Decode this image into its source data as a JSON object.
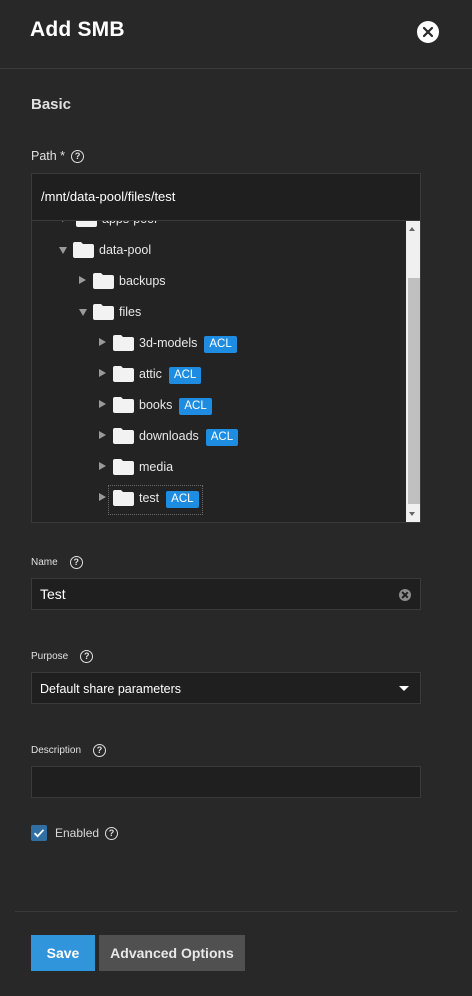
{
  "header": {
    "title": "Add SMB"
  },
  "section": {
    "title": "Basic"
  },
  "path": {
    "label": "Path *",
    "value": "/mnt/data-pool/files/test",
    "tree": [
      {
        "label": "apps-pool",
        "expanded": false,
        "acl": ""
      },
      {
        "label": "data-pool",
        "expanded": true,
        "acl": ""
      },
      {
        "label": "backups",
        "expanded": false,
        "acl": ""
      },
      {
        "label": "files",
        "expanded": true,
        "acl": ""
      },
      {
        "label": "3d-models",
        "expanded": false,
        "acl": "ACL"
      },
      {
        "label": "attic",
        "expanded": false,
        "acl": "ACL"
      },
      {
        "label": "books",
        "expanded": false,
        "acl": "ACL"
      },
      {
        "label": "downloads",
        "expanded": false,
        "acl": "ACL"
      },
      {
        "label": "media",
        "expanded": false,
        "acl": ""
      },
      {
        "label": "test",
        "expanded": false,
        "acl": "ACL",
        "selected": true
      }
    ]
  },
  "name": {
    "label": "Name",
    "value": "Test"
  },
  "purpose": {
    "label": "Purpose",
    "value": "Default share parameters"
  },
  "description": {
    "label": "Description",
    "value": ""
  },
  "enabled": {
    "label": "Enabled",
    "checked": true
  },
  "buttons": {
    "save": "Save",
    "advanced": "Advanced Options"
  },
  "colors": {
    "accent": "#3095da",
    "acl_badge": "#1e8ce0",
    "background": "#282828"
  },
  "help_icon": "?"
}
